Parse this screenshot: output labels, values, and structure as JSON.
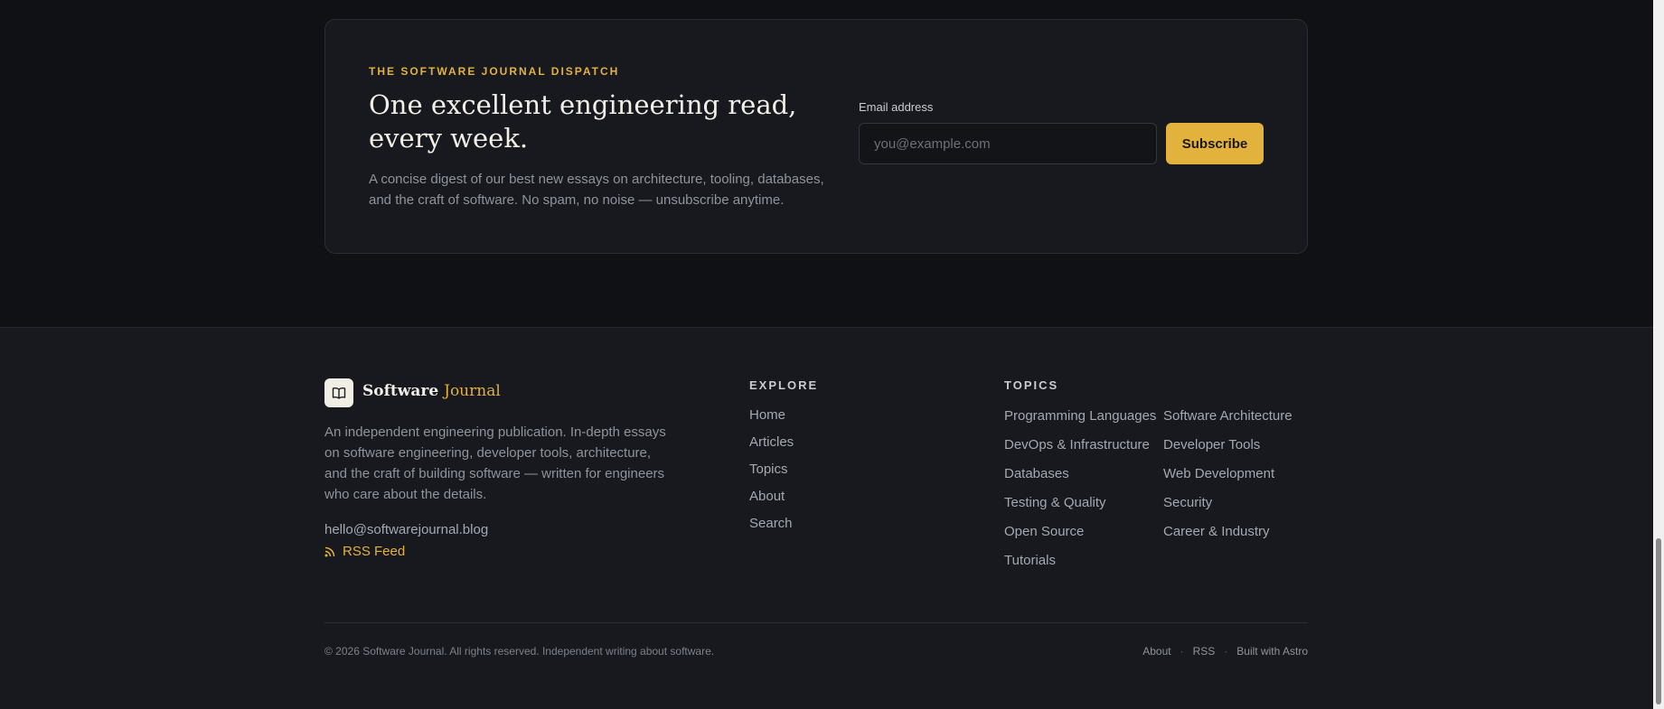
{
  "newsletter": {
    "eyebrow": "THE SOFTWARE JOURNAL DISPATCH",
    "title": "One excellent engineering read, every week.",
    "description": "A concise digest of our best new essays on architecture, tooling, databases, and the craft of software. No spam, no noise — unsubscribe anytime.",
    "email_label": "Email address",
    "email_placeholder": "you@example.com",
    "email_value": "",
    "subscribe_label": "Subscribe"
  },
  "footer": {
    "brand_name": "Software",
    "brand_accent": "Journal",
    "logo_icon": "open-book-icon",
    "description": "An independent engineering publication. In-depth essays on software engineering, developer tools, architecture, and the craft of building software — written for engineers who care about the details.",
    "email": "hello@softwarejournal.blog",
    "rss_label": "RSS Feed",
    "rss_icon": "rss-icon",
    "explore_heading": "EXPLORE",
    "explore_links": [
      "Home",
      "Articles",
      "Topics",
      "About",
      "Search"
    ],
    "topics_heading": "TOPICS",
    "topics": [
      "Programming Languages",
      "Software Architecture",
      "DevOps & Infrastructure",
      "Developer Tools",
      "Databases",
      "Web Development",
      "Testing & Quality",
      "Security",
      "Open Source",
      "Career & Industry",
      "Tutorials"
    ],
    "copyright": "© 2026 Software Journal. All rights reserved. Independent writing about software.",
    "bottom_links": [
      "About",
      "RSS",
      "Built with Astro"
    ],
    "separator": "·"
  },
  "colors": {
    "accent": "#e3b23c",
    "background": "#101115",
    "surface": "#17191e"
  }
}
